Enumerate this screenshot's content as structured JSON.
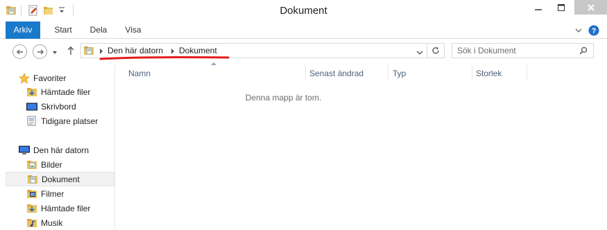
{
  "window": {
    "title": "Dokument"
  },
  "ribbon": {
    "tabs": [
      {
        "label": "Arkiv"
      },
      {
        "label": "Start"
      },
      {
        "label": "Dela"
      },
      {
        "label": "Visa"
      }
    ],
    "accent_color": "#1979ca"
  },
  "address": {
    "crumbs": [
      {
        "label": "Den här datorn"
      },
      {
        "label": "Dokument"
      }
    ]
  },
  "search": {
    "placeholder": "Sök i Dokument"
  },
  "navpane": {
    "favorites_label": "Favoriter",
    "favorites": [
      {
        "label": "Hämtade filer",
        "icon": "downloads-folder-icon"
      },
      {
        "label": "Skrivbord",
        "icon": "desktop-icon"
      },
      {
        "label": "Tidigare platser",
        "icon": "recent-places-icon"
      }
    ],
    "computer_label": "Den här datorn",
    "computer": [
      {
        "label": "Bilder",
        "icon": "pictures-folder-icon"
      },
      {
        "label": "Dokument",
        "icon": "documents-folder-icon",
        "selected": true
      },
      {
        "label": "Filmer",
        "icon": "videos-folder-icon"
      },
      {
        "label": "Hämtade filer",
        "icon": "downloads-folder-icon"
      },
      {
        "label": "Musik",
        "icon": "music-folder-icon"
      }
    ]
  },
  "content": {
    "columns": [
      {
        "label": "Namn"
      },
      {
        "label": "Senast ändrad"
      },
      {
        "label": "Typ"
      },
      {
        "label": "Storlek"
      }
    ],
    "empty_message": "Denna mapp är tom."
  },
  "annotation_color": "#e31b1b"
}
